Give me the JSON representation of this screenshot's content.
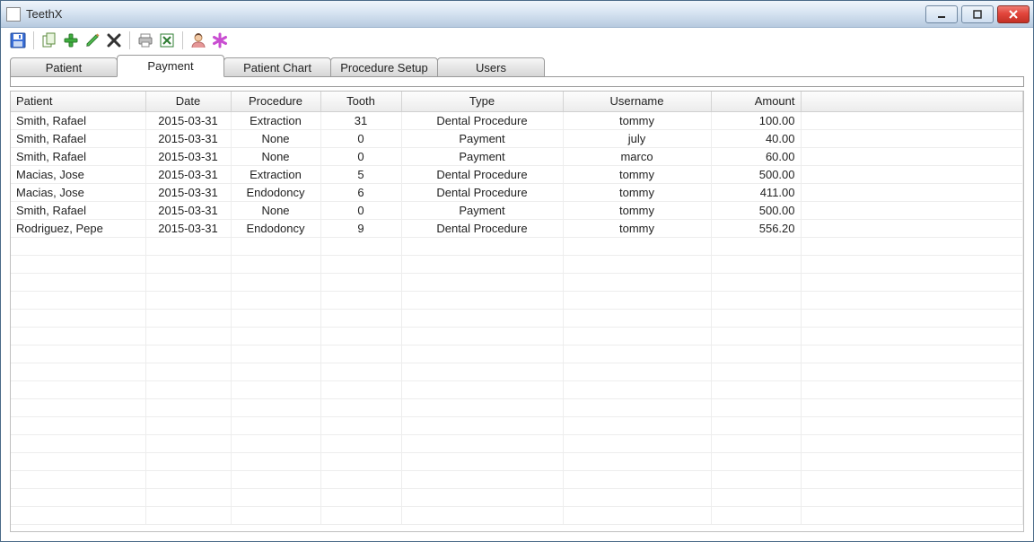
{
  "window": {
    "title": "TeethX"
  },
  "toolbar": {
    "save": "save",
    "copy": "copy",
    "add": "add",
    "edit": "edit",
    "delete": "delete",
    "print": "print",
    "excel": "excel",
    "user": "user",
    "star": "star"
  },
  "tabs": [
    {
      "id": "patient",
      "label": "Patient",
      "active": false
    },
    {
      "id": "payment",
      "label": "Payment",
      "active": true
    },
    {
      "id": "chart",
      "label": "Patient Chart",
      "active": false
    },
    {
      "id": "procsetup",
      "label": "Procedure Setup",
      "active": false
    },
    {
      "id": "users",
      "label": "Users",
      "active": false
    }
  ],
  "table": {
    "columns": {
      "patient": "Patient",
      "date": "Date",
      "procedure": "Procedure",
      "tooth": "Tooth",
      "type": "Type",
      "username": "Username",
      "amount": "Amount"
    },
    "rows": [
      {
        "patient": "Smith, Rafael",
        "date": "2015-03-31",
        "procedure": "Extraction",
        "tooth": "31",
        "type": "Dental Procedure",
        "username": "tommy",
        "amount": "100.00"
      },
      {
        "patient": "Smith, Rafael",
        "date": "2015-03-31",
        "procedure": "None",
        "tooth": "0",
        "type": "Payment",
        "username": "july",
        "amount": "40.00"
      },
      {
        "patient": "Smith, Rafael",
        "date": "2015-03-31",
        "procedure": "None",
        "tooth": "0",
        "type": "Payment",
        "username": "marco",
        "amount": "60.00"
      },
      {
        "patient": "Macias, Jose",
        "date": "2015-03-31",
        "procedure": "Extraction",
        "tooth": "5",
        "type": "Dental Procedure",
        "username": "tommy",
        "amount": "500.00"
      },
      {
        "patient": "Macias, Jose",
        "date": "2015-03-31",
        "procedure": "Endodoncy",
        "tooth": "6",
        "type": "Dental Procedure",
        "username": "tommy",
        "amount": "411.00"
      },
      {
        "patient": "Smith, Rafael",
        "date": "2015-03-31",
        "procedure": "None",
        "tooth": "0",
        "type": "Payment",
        "username": "tommy",
        "amount": "500.00"
      },
      {
        "patient": "Rodriguez, Pepe",
        "date": "2015-03-31",
        "procedure": "Endodoncy",
        "tooth": "9",
        "type": "Dental Procedure",
        "username": "tommy",
        "amount": "556.20"
      }
    ]
  }
}
